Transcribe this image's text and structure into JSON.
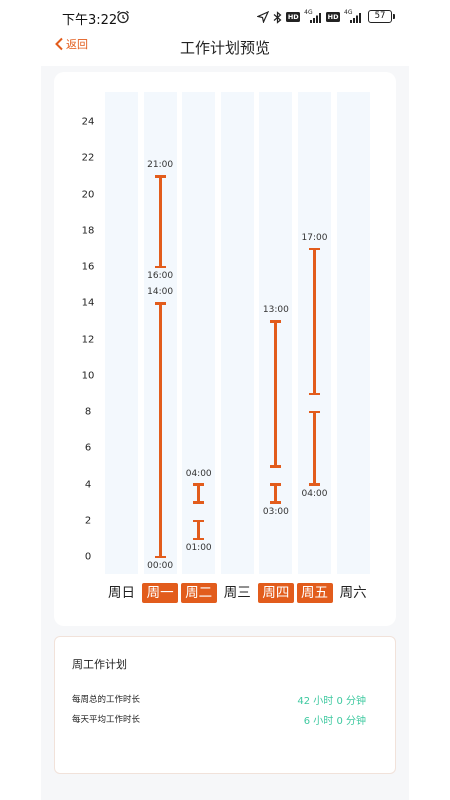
{
  "status_bar": {
    "time": "下午3:22",
    "battery": "57",
    "network_labels": [
      "4G",
      "4G"
    ],
    "hd_labels": [
      "HD",
      "HD"
    ]
  },
  "nav": {
    "back_label": "返回",
    "title": "工作计划预览"
  },
  "colors": {
    "accent": "#e25c1c",
    "value_green": "#3ec9a0",
    "column_bg": "#f3f8fd"
  },
  "chart_data": {
    "type": "bar",
    "y_ticks": [
      "0",
      "2",
      "4",
      "6",
      "8",
      "10",
      "12",
      "14",
      "16",
      "18",
      "20",
      "22",
      "24"
    ],
    "ylim": [
      0,
      24
    ],
    "days": [
      {
        "label": "周日",
        "active": false,
        "segments": []
      },
      {
        "label": "周一",
        "active": true,
        "segments": [
          {
            "start": 0,
            "end": 14,
            "start_label": "00:00",
            "end_label": "14:00"
          },
          {
            "start": 16,
            "end": 21,
            "start_label": "16:00",
            "end_label": "21:00"
          }
        ]
      },
      {
        "label": "周二",
        "active": true,
        "segments": [
          {
            "start": 1,
            "end": 2,
            "start_label": "01:00",
            "end_label": ""
          },
          {
            "start": 3,
            "end": 4,
            "start_label": "",
            "end_label": "04:00"
          }
        ]
      },
      {
        "label": "周三",
        "active": false,
        "segments": []
      },
      {
        "label": "周四",
        "active": true,
        "segments": [
          {
            "start": 3,
            "end": 4,
            "start_label": "03:00",
            "end_label": ""
          },
          {
            "start": 5,
            "end": 13,
            "start_label": "",
            "end_label": "13:00"
          }
        ]
      },
      {
        "label": "周五",
        "active": true,
        "segments": [
          {
            "start": 4,
            "end": 8,
            "start_label": "04:00",
            "end_label": ""
          },
          {
            "start": 9,
            "end": 17,
            "start_label": "",
            "end_label": "17:00"
          }
        ]
      },
      {
        "label": "周六",
        "active": false,
        "segments": []
      }
    ]
  },
  "summary": {
    "title": "周工作计划",
    "rows": [
      {
        "label": "每周总的工作时长",
        "value": "42 小时 0 分钟"
      },
      {
        "label": "每天平均工作时长",
        "value": "6 小时 0 分钟"
      }
    ]
  }
}
